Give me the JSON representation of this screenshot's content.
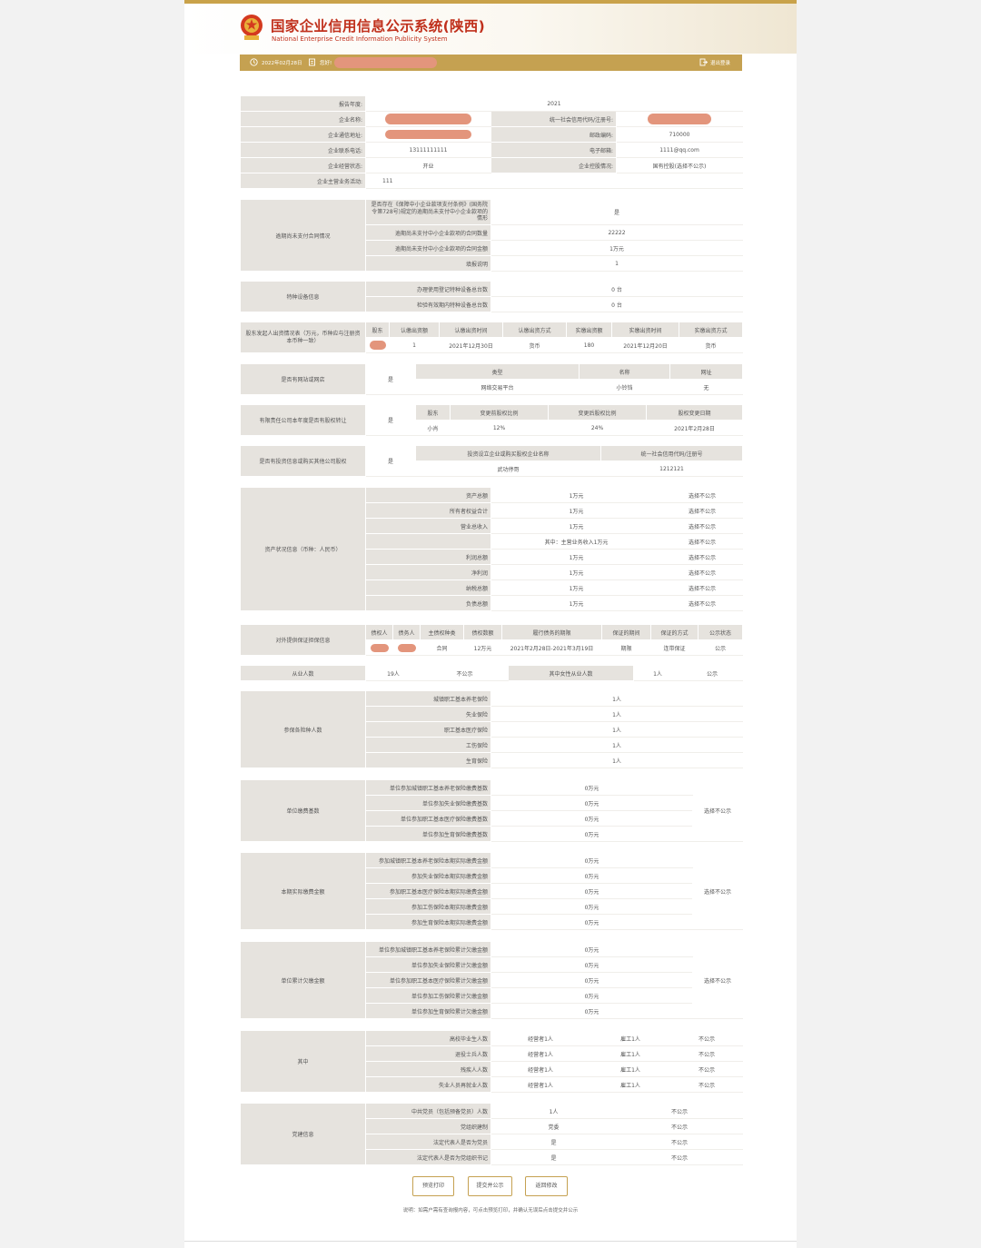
{
  "header": {
    "title_cn": "国家企业信用信息公示系统(陕西)",
    "title_en": "National Enterprise Credit Information Publicity System"
  },
  "bar": {
    "date": "2022年02月28日",
    "user_label": "您好!",
    "logout": "退出登录"
  },
  "basic": {
    "year_label": "报告年度:",
    "year": "2021",
    "name_label": "企业名称:",
    "uscc_label": "统一社会信用代码/注册号:",
    "addr_label": "企业通信地址:",
    "zip_label": "邮政编码:",
    "zip": "710000",
    "phone_label": "企业联系电话:",
    "phone": "13111111111",
    "email_label": "电子邮箱:",
    "email": "1111@qq.com",
    "status_label": "企业经营状态:",
    "status": "开业",
    "holding_label": "企业控股情况:",
    "holding": "国有控股(选择不公示)",
    "business_label": "企业主营业务活动:",
    "business": "111"
  },
  "overdue": {
    "label": "逾期尚未支付合同情况",
    "rows": [
      {
        "k": "是否存在《保障中小企业款项支付条例》(国务院令第728号)规定的逾期尚未支付中小企业款项的情形",
        "v": "是"
      },
      {
        "k": "逾期尚未支付中小企业款项的合同数量",
        "v": "22222"
      },
      {
        "k": "逾期尚未支付中小企业款项的合同金额",
        "v": "1万元"
      },
      {
        "k": "填报说明",
        "v": "1"
      }
    ]
  },
  "equipment": {
    "label": "特种设备信息",
    "rows": [
      {
        "k": "办理使用登记特种设备总台数",
        "v": "0 台"
      },
      {
        "k": "检验有效期内特种设备总台数",
        "v": "0 台"
      }
    ]
  },
  "capital": {
    "label": "股东发起人出资情况表（万元，币种应与注册资本币种一致）",
    "headers": [
      "股东",
      "认缴出资额",
      "认缴出资时间",
      "认缴出资方式",
      "实缴出资额",
      "实缴出资时间",
      "实缴出资方式"
    ],
    "row": [
      "",
      "1",
      "2021年12月30日",
      "货币",
      "180",
      "2021年12月20日",
      "货币"
    ]
  },
  "website": {
    "label": "是否有网站或网店",
    "value": "是",
    "headers": [
      "类型",
      "名称",
      "网址"
    ],
    "row": [
      "网络交易平台",
      "小铃铛",
      "无"
    ]
  },
  "equity_transfer": {
    "label": "有限责任公司本年度是否有股权转让",
    "value": "是",
    "headers": [
      "股东",
      "变更前股权比例",
      "变更后股权比例",
      "股权变更日期"
    ],
    "row": [
      "小肖",
      "12%",
      "24%",
      "2021年2月28日"
    ]
  },
  "investment": {
    "label": "是否有投资信息或购买其他公司股权",
    "value": "是",
    "headers": [
      "投资设立企业或购买股权企业名称",
      "统一社会信用代码/注册号"
    ],
    "row": [
      "武功停哥",
      "1212121"
    ]
  },
  "assets": {
    "label": "资产状况信息（币种：人民币）",
    "rows": [
      {
        "k": "资产总额",
        "v": "1万元",
        "s": "选择不公示"
      },
      {
        "k": "所有者权益合计",
        "v": "1万元",
        "s": "选择不公示"
      },
      {
        "k": "营业总收入",
        "v": "1万元",
        "s": "选择不公示"
      },
      {
        "k": "",
        "v": "其中：主营业务收入1万元",
        "s": "选择不公示"
      },
      {
        "k": "利润总额",
        "v": "1万元",
        "s": "选择不公示"
      },
      {
        "k": "净利润",
        "v": "1万元",
        "s": "选择不公示"
      },
      {
        "k": "纳税总额",
        "v": "1万元",
        "s": "选择不公示"
      },
      {
        "k": "负债总额",
        "v": "1万元",
        "s": "选择不公示"
      }
    ]
  },
  "guarantee": {
    "label": "对外提供保证担保信息",
    "headers": [
      "债权人",
      "债务人",
      "主债权种类",
      "债权数额",
      "履行债务的期限",
      "保证的期间",
      "保证的方式",
      "公示状态"
    ],
    "row": [
      "",
      "",
      "合同",
      "12万元",
      "2021年2月28日-2021年3月19日",
      "期限",
      "连带保证",
      "公示"
    ]
  },
  "employees": {
    "label": "从业人数",
    "value": "19人",
    "status": "不公示",
    "female_label": "其中女性从业人数",
    "female": "1人",
    "female_status": "公示"
  },
  "insurance": {
    "label": "参保各险种人数",
    "rows": [
      {
        "k": "城镇职工基本养老保险",
        "v": "1人"
      },
      {
        "k": "失业保险",
        "v": "1人"
      },
      {
        "k": "职工基本医疗保险",
        "v": "1人"
      },
      {
        "k": "工伤保险",
        "v": "1人"
      },
      {
        "k": "生育保险",
        "v": "1人"
      }
    ]
  },
  "base": {
    "label": "单位缴费基数",
    "status": "选择不公示",
    "rows": [
      {
        "k": "单位参加城镇职工基本养老保险缴费基数",
        "v": "0万元"
      },
      {
        "k": "单位参加失业保险缴费基数",
        "v": "0万元"
      },
      {
        "k": "单位参加职工基本医疗保险缴费基数",
        "v": "0万元"
      },
      {
        "k": "单位参加生育保险缴费基数",
        "v": "0万元"
      }
    ]
  },
  "actual": {
    "label": "本期实际缴费金额",
    "status": "选择不公示",
    "rows": [
      {
        "k": "参加城镇职工基本养老保险本期实际缴费金额",
        "v": "0万元"
      },
      {
        "k": "参加失业保险本期实际缴费金额",
        "v": "0万元"
      },
      {
        "k": "参加职工基本医疗保险本期实际缴费金额",
        "v": "0万元"
      },
      {
        "k": "参加工伤保险本期实际缴费金额",
        "v": "0万元"
      },
      {
        "k": "参加生育保险本期实际缴费金额",
        "v": "0万元"
      }
    ]
  },
  "arrears": {
    "label": "单位累计欠缴金额",
    "status": "选择不公示",
    "rows": [
      {
        "k": "单位参加城镇职工基本养老保险累计欠缴金额",
        "v": "0万元"
      },
      {
        "k": "单位参加失业保险累计欠缴金额",
        "v": "0万元"
      },
      {
        "k": "单位参加职工基本医疗保险累计欠缴金额",
        "v": "0万元"
      },
      {
        "k": "单位参加工伤保险累计欠缴金额",
        "v": "0万元"
      },
      {
        "k": "单位参加生育保险累计欠缴金额",
        "v": "0万元"
      }
    ]
  },
  "among": {
    "label": "其中",
    "rows": [
      {
        "k": "高校毕业生人数",
        "a": "经营者1人",
        "b": "雇工1人",
        "s": "不公示"
      },
      {
        "k": "退役士兵人数",
        "a": "经营者1人",
        "b": "雇工1人",
        "s": "不公示"
      },
      {
        "k": "残疾人人数",
        "a": "经营者1人",
        "b": "雇工1人",
        "s": "不公示"
      },
      {
        "k": "失业人员再就业人数",
        "a": "经营者1人",
        "b": "雇工1人",
        "s": "不公示"
      }
    ]
  },
  "party": {
    "label": "党建信息",
    "rows": [
      {
        "k": "中共党员（包括预备党员）人数",
        "v": "1人",
        "s": "不公示"
      },
      {
        "k": "党组织建制",
        "v": "党委",
        "s": "不公示"
      },
      {
        "k": "法定代表人是否为党员",
        "v": "是",
        "s": "不公示"
      },
      {
        "k": "法定代表人是否为党组织书记",
        "v": "是",
        "s": "不公示"
      }
    ]
  },
  "buttons": {
    "print": "预览打印",
    "submit": "提交并公示",
    "back": "返回修改"
  },
  "note": "说明：如需户需有查询报内容，可点击预览打印，并确认无误后点击提交并公示"
}
